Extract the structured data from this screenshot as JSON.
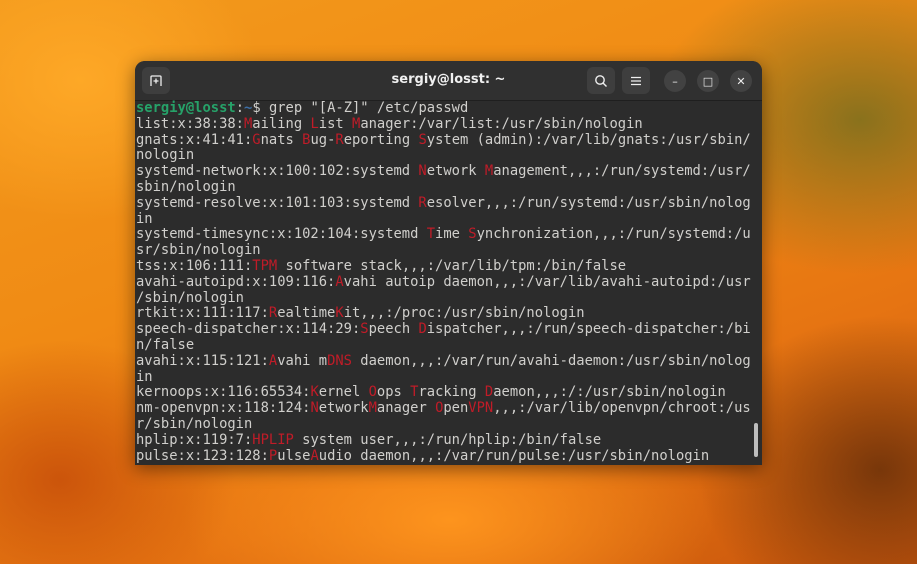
{
  "window": {
    "title": "sergiy@losst: ~",
    "new_tab_icon": "new-tab-icon",
    "search_icon": "search-icon",
    "menu_icon": "hamburger-menu-icon",
    "minimize": "–",
    "maximize": "□",
    "close": "✕"
  },
  "prompt": {
    "user": "sergiy@losst",
    "sep": ":",
    "path": "~",
    "symbol": "$ ",
    "command": "grep \"[A-Z]\" /etc/passwd"
  },
  "colors": {
    "match": "#c01c28",
    "prompt_user": "#26a269",
    "prompt_path": "#3d6ea5",
    "bg": "#2c2c2c",
    "text": "#d0cfcc"
  },
  "lines": [
    [
      [
        "list:x:38:38:",
        0
      ],
      [
        "M",
        1
      ],
      [
        "ailing ",
        0
      ],
      [
        "L",
        1
      ],
      [
        "ist ",
        0
      ],
      [
        "M",
        1
      ],
      [
        "anager:/var/list:/usr/sbin/nologin",
        0
      ]
    ],
    [
      [
        "gnats:x:41:41:",
        0
      ],
      [
        "G",
        1
      ],
      [
        "nats ",
        0
      ],
      [
        "B",
        1
      ],
      [
        "ug-",
        0
      ],
      [
        "R",
        1
      ],
      [
        "eporting ",
        0
      ],
      [
        "S",
        1
      ],
      [
        "ystem (admin):/var/lib/gnats:/usr/sbin/",
        0
      ]
    ],
    [
      [
        "nologin",
        0
      ]
    ],
    [
      [
        "systemd-network:x:100:102:systemd ",
        0
      ],
      [
        "N",
        1
      ],
      [
        "etwork ",
        0
      ],
      [
        "M",
        1
      ],
      [
        "anagement,,,:/run/systemd:/usr/",
        0
      ]
    ],
    [
      [
        "sbin/nologin",
        0
      ]
    ],
    [
      [
        "systemd-resolve:x:101:103:systemd ",
        0
      ],
      [
        "R",
        1
      ],
      [
        "esolver,,,:/run/systemd:/usr/sbin/nolog",
        0
      ]
    ],
    [
      [
        "in",
        0
      ]
    ],
    [
      [
        "systemd-timesync:x:102:104:systemd ",
        0
      ],
      [
        "T",
        1
      ],
      [
        "ime ",
        0
      ],
      [
        "S",
        1
      ],
      [
        "ynchronization,,,:/run/systemd:/u",
        0
      ]
    ],
    [
      [
        "sr/sbin/nologin",
        0
      ]
    ],
    [
      [
        "tss:x:106:111:",
        0
      ],
      [
        "TPM",
        1
      ],
      [
        " software stack,,,:/var/lib/tpm:/bin/false",
        0
      ]
    ],
    [
      [
        "avahi-autoipd:x:109:116:",
        0
      ],
      [
        "A",
        1
      ],
      [
        "vahi autoip daemon,,,:/var/lib/avahi-autoipd:/usr",
        0
      ]
    ],
    [
      [
        "/sbin/nologin",
        0
      ]
    ],
    [
      [
        "rtkit:x:111:117:",
        0
      ],
      [
        "R",
        1
      ],
      [
        "ealtime",
        0
      ],
      [
        "K",
        1
      ],
      [
        "it,,,:/proc:/usr/sbin/nologin",
        0
      ]
    ],
    [
      [
        "speech-dispatcher:x:114:29:",
        0
      ],
      [
        "S",
        1
      ],
      [
        "peech ",
        0
      ],
      [
        "D",
        1
      ],
      [
        "ispatcher,,,:/run/speech-dispatcher:/bi",
        0
      ]
    ],
    [
      [
        "n/false",
        0
      ]
    ],
    [
      [
        "avahi:x:115:121:",
        0
      ],
      [
        "A",
        1
      ],
      [
        "vahi m",
        0
      ],
      [
        "DNS",
        1
      ],
      [
        " daemon,,,:/var/run/avahi-daemon:/usr/sbin/nolog",
        0
      ]
    ],
    [
      [
        "in",
        0
      ]
    ],
    [
      [
        "kernoops:x:116:65534:",
        0
      ],
      [
        "K",
        1
      ],
      [
        "ernel ",
        0
      ],
      [
        "O",
        1
      ],
      [
        "ops ",
        0
      ],
      [
        "T",
        1
      ],
      [
        "racking ",
        0
      ],
      [
        "D",
        1
      ],
      [
        "aemon,,,:/:/usr/sbin/nologin",
        0
      ]
    ],
    [
      [
        "nm-openvpn:x:118:124:",
        0
      ],
      [
        "N",
        1
      ],
      [
        "etwork",
        0
      ],
      [
        "M",
        1
      ],
      [
        "anager ",
        0
      ],
      [
        "O",
        1
      ],
      [
        "pen",
        0
      ],
      [
        "VPN",
        1
      ],
      [
        ",,,:/var/lib/openvpn/chroot:/us",
        0
      ]
    ],
    [
      [
        "r/sbin/nologin",
        0
      ]
    ],
    [
      [
        "hplip:x:119:7:",
        0
      ],
      [
        "HPLIP",
        1
      ],
      [
        " system user,,,:/run/hplip:/bin/false",
        0
      ]
    ],
    [
      [
        "pulse:x:123:128:",
        0
      ],
      [
        "P",
        1
      ],
      [
        "ulse",
        0
      ],
      [
        "A",
        1
      ],
      [
        "udio daemon,,,:/var/run/pulse:/usr/sbin/nologin",
        0
      ]
    ]
  ]
}
